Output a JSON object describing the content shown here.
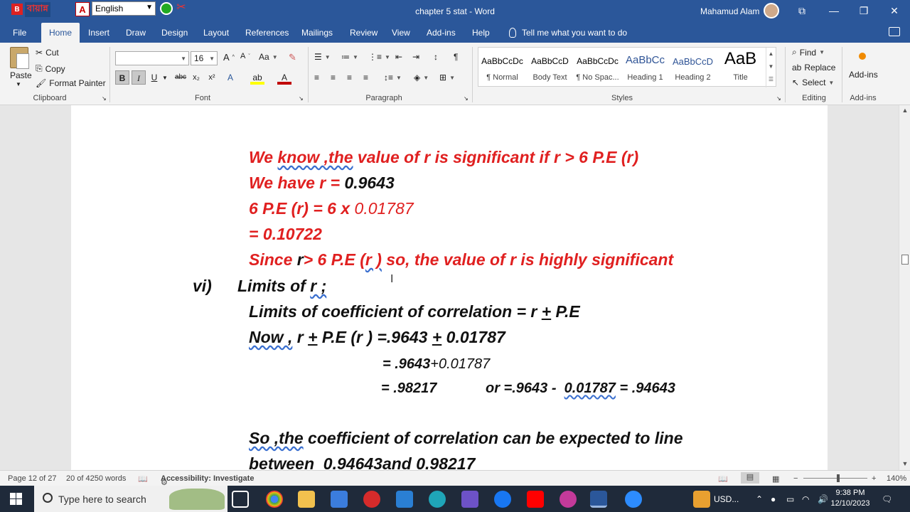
{
  "titlebar": {
    "bijoy_label": "বায়ান্ন",
    "language": "English",
    "doc_title": "chapter 5 stat  -  Word",
    "user": "Mahamud Alam"
  },
  "tabs": [
    "File",
    "Home",
    "Insert",
    "Draw",
    "Design",
    "Layout",
    "References",
    "Mailings",
    "Review",
    "View",
    "Add-ins",
    "Help"
  ],
  "tell_me": "Tell me what you want to do",
  "clipboard": {
    "paste": "Paste",
    "cut": "Cut",
    "copy": "Copy",
    "format_painter": "Format Painter",
    "label": "Clipboard"
  },
  "font": {
    "name": "",
    "size": "16",
    "label": "Font"
  },
  "paragraph": {
    "label": "Paragraph"
  },
  "styles": {
    "label": "Styles",
    "items": [
      {
        "preview": "AaBbCcDc",
        "name": "¶ Normal"
      },
      {
        "preview": "AaBbCcD",
        "name": "Body Text"
      },
      {
        "preview": "AaBbCcDc",
        "name": "¶ No Spac..."
      },
      {
        "preview": "AaBbCc",
        "name": "Heading 1"
      },
      {
        "preview": "AaBbCcD",
        "name": "Heading 2"
      },
      {
        "preview": "AaB",
        "name": "Title"
      }
    ]
  },
  "editing": {
    "find": "Find",
    "replace": "Replace",
    "select": "Select",
    "label": "Editing"
  },
  "addins": {
    "button": "Add-ins",
    "label": "Add-ins"
  },
  "doc": {
    "l1_a": "We ",
    "l1_b": "know ,the",
    "l1_c": " value of r is significant if r > 6 P.E (r)",
    "l2_a": "We have r = ",
    "l2_b": "0.9643",
    "l3_a": "6 P.E (r) = 6 x ",
    "l3_b": "0.01787",
    "l4": "= 0.10722",
    "l5_a": "Since ",
    "l5_b": "r",
    "l5_c": "> 6 P.E (",
    "l5_d": "r )",
    "l5_e": " so, the value of r is highly significant",
    "l6_num": "vi)",
    "l6_a": "Limits of ",
    "l6_b": "r ;",
    "l7_a": "Limits of coefficient of correlation = r ",
    "l7_b": "+",
    "l7_c": " P.E",
    "l8_a": "Now ,",
    "l8_b": " r ",
    "l8_c": "+",
    "l8_d": " P.E (r ) =.9643 ",
    "l8_e": "+",
    "l8_f": " 0.01787",
    "l9_a": "= .9643",
    "l9_b": "+0.01787",
    "l10_a": "= .98217",
    "l10_b": "or =.9643 -  ",
    "l10_c": "0.01787",
    "l10_d": " = .94643",
    "l11_a": "So ,the",
    "l11_b": " coefficient of correlation can be expected to line",
    "l12": "between  0.94643and 0.98217"
  },
  "status": {
    "page": "Page 12 of 27",
    "words": "20 of 4250 words",
    "accessibility": "Accessibility: Investigate",
    "zoom": "140%"
  },
  "taskbar": {
    "search_placeholder": "Type here to search",
    "currency": "USD...",
    "time": "9:38 PM",
    "date": "12/10/2023"
  }
}
